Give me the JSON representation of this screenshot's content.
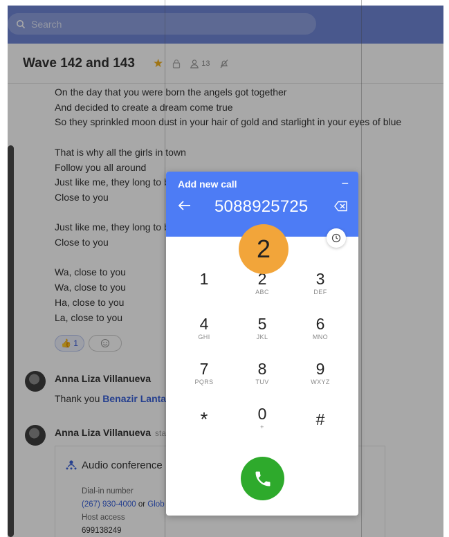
{
  "search": {
    "placeholder": "Search"
  },
  "header": {
    "title": "Wave 142 and 143",
    "member_count": "13"
  },
  "messages": {
    "lines_1": [
      "On the day that you were born the angels got together",
      "And decided to create a dream come true",
      "So they sprinkled moon dust in your hair of gold and starlight in your eyes of blue"
    ],
    "lines_2": [
      "That is why all the girls in town",
      "Follow you all around",
      "Just like me, they long to be",
      "Close to you"
    ],
    "lines_3": [
      "Just like me, they long to be",
      "Close to you"
    ],
    "lines_4": [
      "Wa, close to you",
      "Wa, close to you",
      "Ha, close to you",
      "La, close to you"
    ]
  },
  "reactions": {
    "thumbs_emoji": "👍",
    "thumbs_count": "1"
  },
  "posts": [
    {
      "author": "Anna Liza Villanueva",
      "status": "",
      "text_prefix": "Thank you ",
      "mention": "Benazir Lantan"
    },
    {
      "author": "Anna Liza Villanueva",
      "status": "sta"
    }
  ],
  "conference": {
    "title": "Audio conference",
    "dial_in_label": "Dial-in number",
    "dial_in_number": "(267) 930-4000",
    "or": "or",
    "global_link": "Glob",
    "host_access_label": "Host access",
    "host_access_number": "699138249"
  },
  "dialer": {
    "title": "Add new call",
    "minimize": "−",
    "number": "5088925725",
    "keys": [
      {
        "digit": "1",
        "letters": ""
      },
      {
        "digit": "2",
        "letters": "ABC"
      },
      {
        "digit": "3",
        "letters": "DEF"
      },
      {
        "digit": "4",
        "letters": "GHI"
      },
      {
        "digit": "5",
        "letters": "JKL"
      },
      {
        "digit": "6",
        "letters": "MNO"
      },
      {
        "digit": "7",
        "letters": "PQRS"
      },
      {
        "digit": "8",
        "letters": "TUV"
      },
      {
        "digit": "9",
        "letters": "WXYZ"
      },
      {
        "digit": "*",
        "letters": ""
      },
      {
        "digit": "0",
        "letters": "+"
      },
      {
        "digit": "#",
        "letters": ""
      }
    ]
  },
  "step_badge": "2",
  "colors": {
    "dialer_header": "#4d7cf5",
    "call_button": "#2eaa2c",
    "badge": "#f2a53a",
    "star": "#f2b01e"
  },
  "icons": [
    "search-icon",
    "star-icon",
    "lock-icon",
    "member-icon",
    "bell-off-icon",
    "back-arrow-icon",
    "backspace-icon",
    "history-icon",
    "phone-icon",
    "conference-icon"
  ]
}
